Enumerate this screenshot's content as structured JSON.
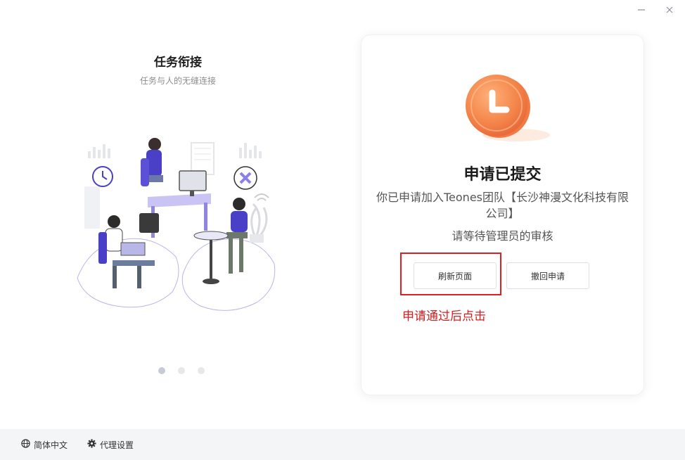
{
  "window": {
    "minimize_icon": "minimize-icon",
    "close_icon": "close-icon"
  },
  "onboarding": {
    "title": "任务衔接",
    "subtitle": "任务与人的无缝连接",
    "illustration": "team-collaboration-illustration",
    "slides_total": 3,
    "active_slide": 1
  },
  "status_card": {
    "icon": "clock-icon",
    "title": "申请已提交",
    "message": "你已申请加入Teones团队【长沙神漫文化科技有限公司】",
    "wait_text": "请等待管理员的审核",
    "refresh_label": "刷新页面",
    "withdraw_label": "撤回申请",
    "annotation": "申请通过后点击",
    "accent_color": "#f4874b",
    "annotation_color": "#e02020"
  },
  "footer": {
    "language_icon": "globe-icon",
    "language_label": "简体中文",
    "proxy_icon": "gear-icon",
    "proxy_label": "代理设置"
  }
}
